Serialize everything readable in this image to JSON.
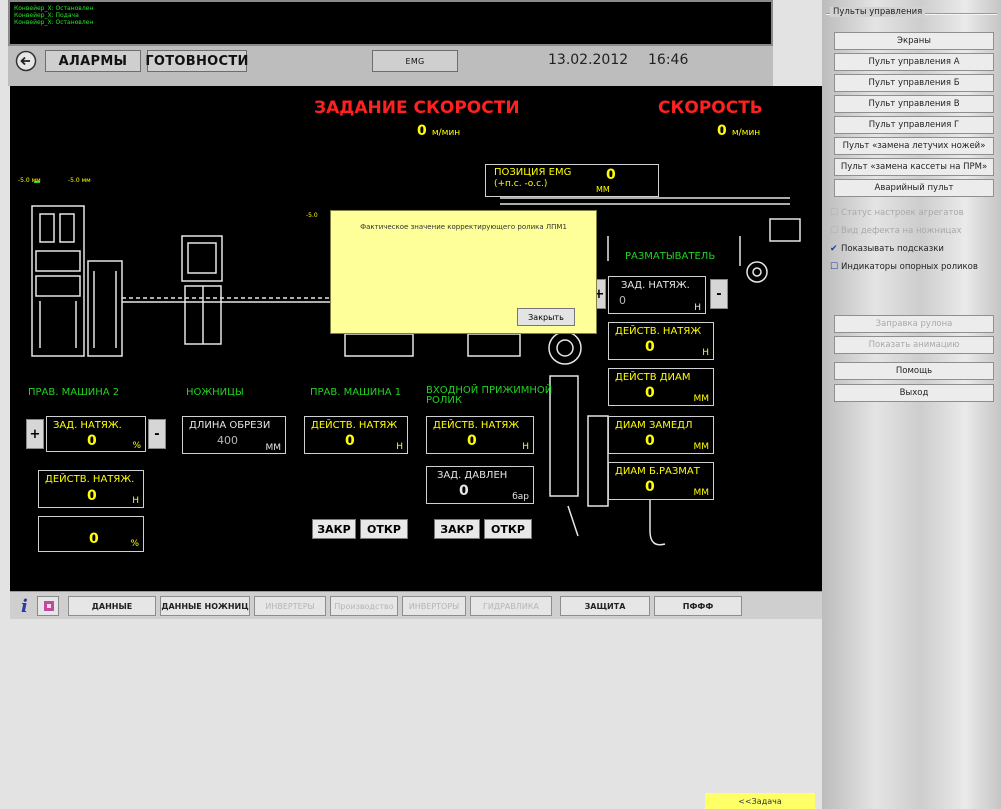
{
  "messages": [
    "Конвейер_Х: Остановлен",
    "Конвейер_Х: Подача",
    "Конвейер_Х: Остановлен"
  ],
  "header": {
    "alarms_label": "АЛАРМЫ",
    "ready_label": "ГОТОВНОСТИ",
    "emg_label": "EMG",
    "date": "13.02.2012",
    "time": "16:46"
  },
  "speed_setpoint": {
    "title": "ЗАДАНИЕ СКОРОСТИ",
    "value": "0",
    "unit": "м/мин"
  },
  "speed_actual": {
    "title": "СКОРОСТЬ",
    "value": "0",
    "unit": "м/мин"
  },
  "emg_position": {
    "label": "ПОЗИЦИЯ EMG",
    "sublabel": "(+п.с.  -о.с.)",
    "value": "0",
    "unit": "ММ"
  },
  "gauges": {
    "a": "-5.0",
    "b": "-5.0",
    "c": "-5.0",
    "unit": "мм"
  },
  "uncoiler": {
    "title": "РАЗМАТЫВАТЕЛЬ"
  },
  "labels": {
    "leveller2": "ПРАВ. МАШИНА 2",
    "shears": "НОЖНИЦЫ",
    "leveller1": "ПРАВ. МАШИНА 1",
    "entry_pinch": "ВХОДНОЙ ПРИЖИМНОЙ РОЛИК"
  },
  "panels": {
    "set_tension_left": {
      "label": "ЗАД. НАТЯЖ.",
      "value": "0",
      "unit": "%"
    },
    "actual_tension_left": {
      "label": "ДЕЙСТВ. НАТЯЖ.",
      "value": "0",
      "unit": "H"
    },
    "percent_left": {
      "value": "0",
      "unit": "%"
    },
    "trim_length": {
      "label": "ДЛИНА ОБРЕЗИ",
      "value": "400",
      "unit": "ММ"
    },
    "actual_tension_mid": {
      "label": "ДЕЙСТВ. НАТЯЖ",
      "value": "0",
      "unit": "H"
    },
    "actual_tension_pinch": {
      "label": "ДЕЙСТВ. НАТЯЖ",
      "value": "0",
      "unit": "H"
    },
    "set_pressure": {
      "label": "ЗАД. ДАВЛЕН",
      "value": "0",
      "unit": "бар"
    },
    "set_tension_right": {
      "label": "ЗАД. НАТЯЖ.",
      "value": "0",
      "unit": "H"
    },
    "actual_tension_right": {
      "label": "ДЕЙСТВ. НАТЯЖ",
      "value": "0",
      "unit": "H"
    },
    "actual_diameter": {
      "label": "ДЕЙСТВ ДИАМ",
      "value": "0",
      "unit": "ММ"
    },
    "slowdown_diameter": {
      "label": "ДИАМ ЗАМЕДЛ",
      "value": "0",
      "unit": "ММ"
    },
    "fast_uncoil_diameter": {
      "label": "ДИАМ Б.РАЗМАТ",
      "value": "0",
      "unit": "ММ"
    }
  },
  "buttons": {
    "plus": "+",
    "minus": "-",
    "close1": "ЗАКР",
    "open1": "ОТКР",
    "close2": "ЗАКР",
    "open2": "ОТКР"
  },
  "dialog": {
    "text": "Фактическое значение корректирующего ролика ЛПМ1",
    "close_label": "Закрыть"
  },
  "tabs": [
    {
      "label": "ДАННЫЕ",
      "enabled": true
    },
    {
      "label": "ДАННЫЕ НОЖНИЦ",
      "enabled": true
    },
    {
      "label": "ИНВЕРТЕРЫ",
      "enabled": false
    },
    {
      "label": "Производство",
      "enabled": false
    },
    {
      "label": "ИНВЕРТОРЫ",
      "enabled": false
    },
    {
      "label": "ГИДРАВЛИКА",
      "enabled": false
    },
    {
      "label": "ЗАЩИТА",
      "enabled": true
    },
    {
      "label": "ПФФФ",
      "enabled": true
    }
  ],
  "task_button": "<<Задача",
  "sidebar": {
    "group_title": "Пульты управления",
    "buttons": [
      {
        "label": "Экраны",
        "enabled": true
      },
      {
        "label": "Пульт управления А",
        "enabled": true
      },
      {
        "label": "Пульт управления Б",
        "enabled": true
      },
      {
        "label": "Пульт управления В",
        "enabled": true
      },
      {
        "label": "Пульт управления Г",
        "enabled": true
      },
      {
        "label": "Пульт «замена летучих ножей»",
        "enabled": true
      },
      {
        "label": "Пульт «замена кассеты на ПРМ»",
        "enabled": true
      },
      {
        "label": "Аварийный пульт",
        "enabled": true
      }
    ],
    "checks": [
      {
        "label": "Статус настроек агрегатов",
        "checked": false,
        "enabled": false
      },
      {
        "label": "Вид дефекта на ножницах",
        "checked": false,
        "enabled": false
      },
      {
        "label": "Показывать подсказки",
        "checked": true,
        "enabled": true
      },
      {
        "label": "Индикаторы опорных роликов",
        "checked": false,
        "enabled": true
      }
    ],
    "lower_buttons": [
      {
        "label": "Заправка рулона",
        "enabled": false
      },
      {
        "label": "Показать анимацию",
        "enabled": false
      },
      {
        "label": "Помощь",
        "enabled": true
      },
      {
        "label": "Выход",
        "enabled": true
      }
    ]
  },
  "colors": {
    "background": "#000000",
    "value_yellow": "#ffff00",
    "label_green": "#23d223",
    "title_red": "#ff2020",
    "dialog_yellow": "#ffff99"
  }
}
